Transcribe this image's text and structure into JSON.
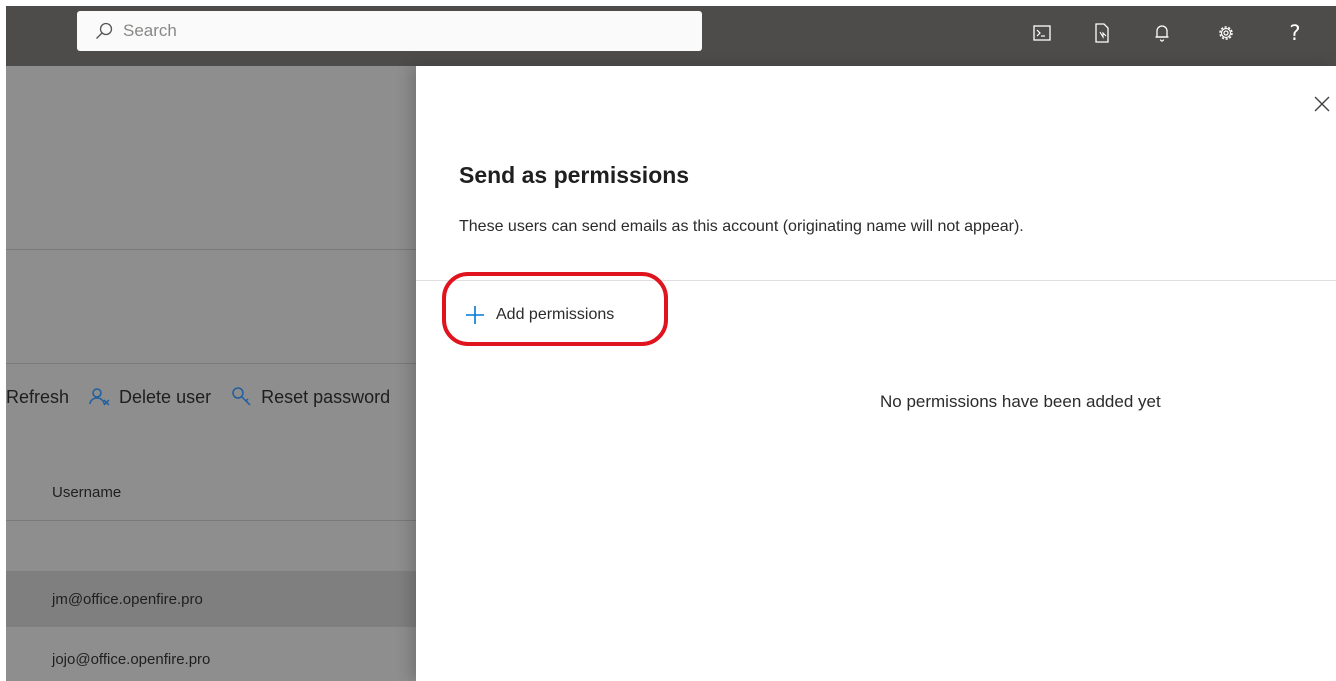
{
  "topbar": {
    "search_placeholder": "Search",
    "icons": [
      "terminal-icon",
      "document-link-icon",
      "bell-icon",
      "gear-icon",
      "help-icon"
    ]
  },
  "background_page": {
    "toolbar": {
      "refresh_label": "Refresh",
      "delete_user_label": "Delete user",
      "reset_password_label": "Reset password"
    },
    "table": {
      "column_username": "Username",
      "rows": [
        {
          "username": "jm@office.openfire.pro"
        },
        {
          "username": "jojo@office.openfire.pro"
        }
      ]
    }
  },
  "panel": {
    "title": "Send as permissions",
    "description": "These users can send emails as this account (originating name will not appear).",
    "add_button_label": "Add permissions",
    "empty_message": "No permissions have been added yet"
  },
  "colors": {
    "topbar": "#4e4c4a",
    "accent": "#0078d4",
    "highlight": "#e0141e"
  }
}
